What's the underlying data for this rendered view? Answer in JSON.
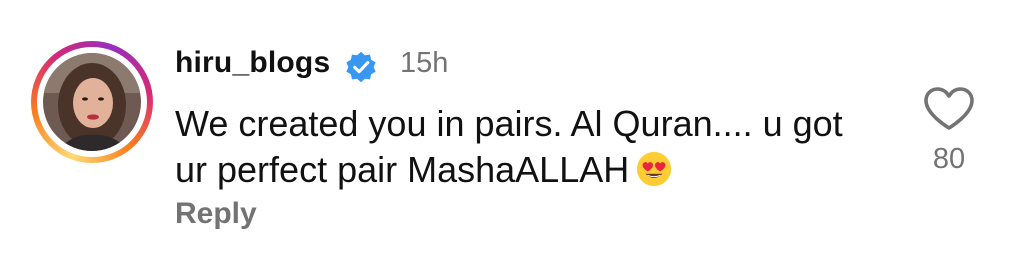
{
  "comment": {
    "username": "hiru_blogs",
    "verified": true,
    "timestamp": "15h",
    "text": "We created you in pairs. Al Quran.... u got ur perfect pair MashaALLAH",
    "emoji": "heart-eyes-emoji",
    "reply_label": "Reply",
    "like_count": "80",
    "like_icon": "heart-outline-icon",
    "colors": {
      "verified_badge": "#3897f0",
      "secondary_text": "#737373",
      "primary_text": "#111111",
      "story_ring": [
        "#feda75",
        "#fa7e1e",
        "#d62976",
        "#962fbf"
      ]
    }
  }
}
